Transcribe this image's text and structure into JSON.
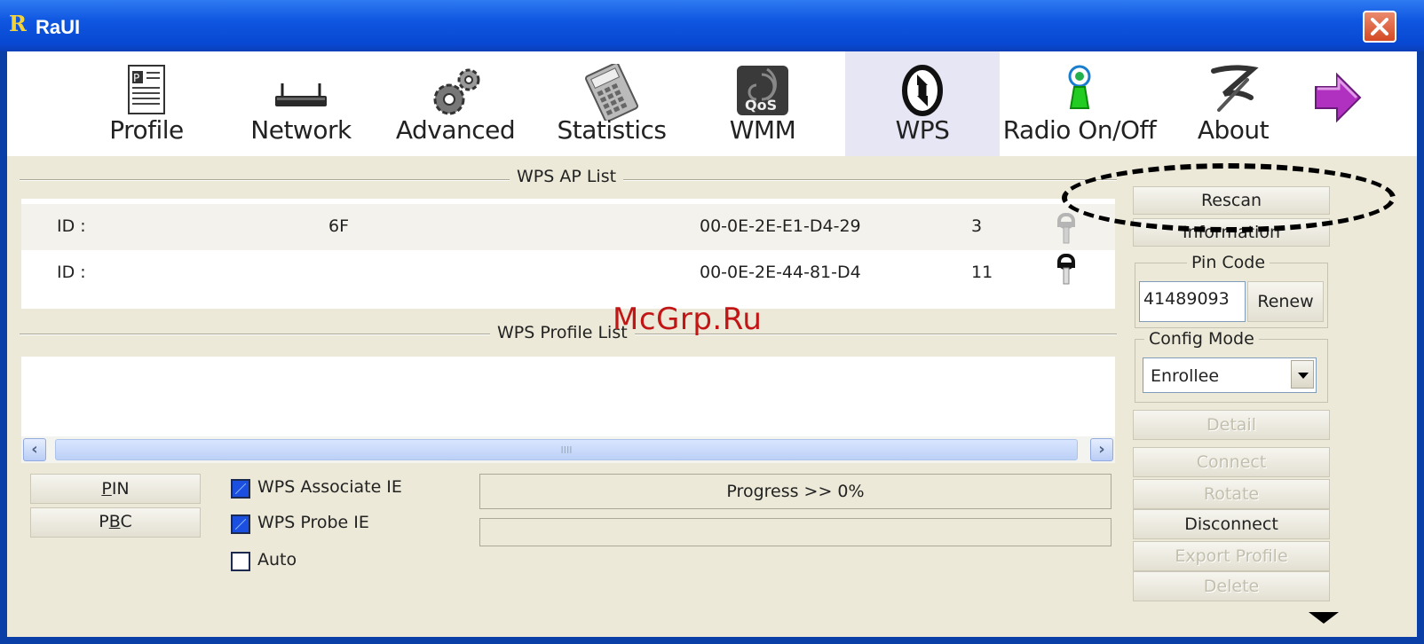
{
  "window": {
    "title": "RaUI",
    "logo": "R"
  },
  "toolbar": {
    "items": [
      {
        "label": "Profile",
        "icon": "profile-icon"
      },
      {
        "label": "Network",
        "icon": "network-icon"
      },
      {
        "label": "Advanced",
        "icon": "advanced-icon"
      },
      {
        "label": "Statistics",
        "icon": "statistics-icon"
      },
      {
        "label": "WMM",
        "icon": "wmm-icon"
      },
      {
        "label": "WPS",
        "icon": "wps-icon",
        "active": true
      },
      {
        "label": "Radio On/Off",
        "icon": "radio-icon"
      },
      {
        "label": "About",
        "icon": "about-icon"
      }
    ],
    "next_icon": "arrow-right-icon"
  },
  "ap_list": {
    "title": "WPS AP List",
    "rows": [
      {
        "id_label": "ID :",
        "ssid": "6F",
        "bssid": "00-0E-2E-E1-D4-29",
        "channel": "3"
      },
      {
        "id_label": "ID :",
        "ssid": "",
        "bssid": "00-0E-2E-44-81-D4",
        "channel": "11"
      }
    ]
  },
  "profile_list": {
    "title": "WPS Profile List"
  },
  "buttons": {
    "pin_label": "PIN",
    "pin_underline": "P",
    "pin_rest": "IN",
    "pbc_label": "PBC",
    "pbc_pre": "P",
    "pbc_underline": "B",
    "pbc_rest": "C",
    "rescan": "Rescan",
    "information": "Information",
    "renew": "Renew",
    "detail": "Detail",
    "connect": "Connect",
    "rotate": "Rotate",
    "disconnect": "Disconnect",
    "export_profile": "Export Profile",
    "delete": "Delete"
  },
  "checkboxes": {
    "associate_ie": {
      "label": "WPS Associate IE",
      "checked": true
    },
    "probe_ie": {
      "label": "WPS Probe IE",
      "checked": true
    },
    "auto": {
      "label": "Auto",
      "checked": false
    }
  },
  "progress": {
    "text": "Progress >> 0%",
    "percent": 0
  },
  "pin_code": {
    "title": "Pin Code",
    "value": "41489093"
  },
  "config_mode": {
    "title": "Config Mode",
    "selected": "Enrollee"
  },
  "watermark": "McGrp.Ru"
}
